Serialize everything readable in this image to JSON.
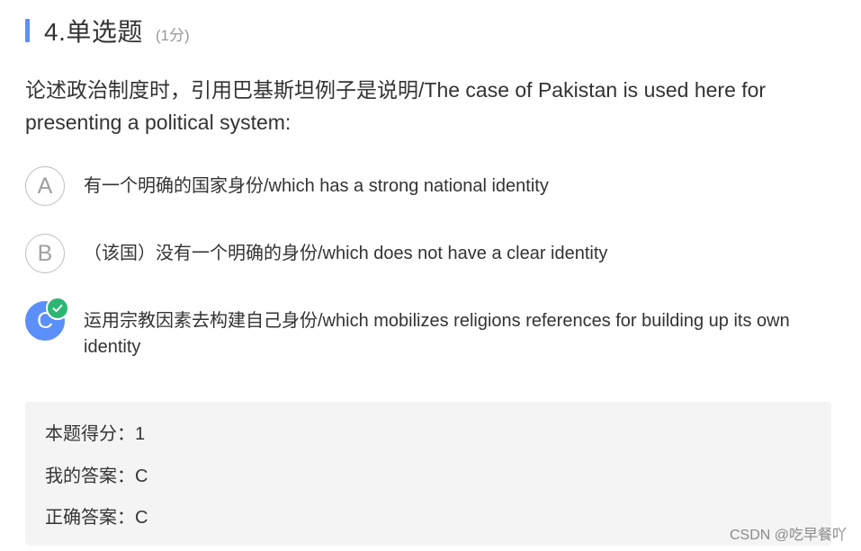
{
  "question": {
    "title": "4.单选题",
    "score": "(1分)",
    "stem": "论述政治制度时，引用巴基斯坦例子是说明/The case of Pakistan is used here for presenting a political system:"
  },
  "options": [
    {
      "letter": "A",
      "text": "有一个明确的国家身份/which has a strong national identity",
      "selected": false
    },
    {
      "letter": "B",
      "text": "（该国）没有一个明确的身份/which does not have a clear identity",
      "selected": false
    },
    {
      "letter": "C",
      "text": "运用宗教因素去构建自己身份/which mobilizes religions references for building up its own identity",
      "selected": true
    }
  ],
  "result": {
    "score_line": "本题得分：1",
    "my_answer_line": "我的答案：C",
    "correct_answer_line": "正确答案：C"
  },
  "watermark": "CSDN @吃早餐吖",
  "colors": {
    "accent": "#5b8ff9",
    "correct": "#2bb673",
    "result_bg": "#f4f4f4"
  }
}
